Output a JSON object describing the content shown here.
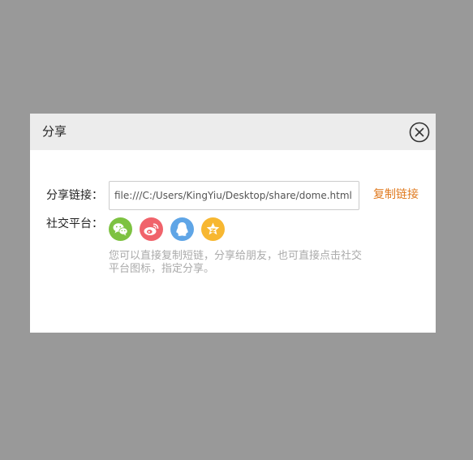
{
  "dialog": {
    "title": "分享",
    "close_icon": "close-icon"
  },
  "share": {
    "link_label": "分享链接：",
    "link_value": "file:///C:/Users/KingYiu/Desktop/share/dome.html",
    "copy_label": "复制链接",
    "social_label": "社交平台：",
    "platforms": [
      {
        "name": "wechat",
        "icon": "wechat-icon",
        "color": "#7dc241"
      },
      {
        "name": "weibo",
        "icon": "weibo-icon",
        "color": "#f0636b"
      },
      {
        "name": "qq",
        "icon": "qq-icon",
        "color": "#5fa5e6"
      },
      {
        "name": "qzone",
        "icon": "qzone-star-icon",
        "color": "#f7b731"
      }
    ],
    "hint": "您可以直接复制短链，分享给朋友，也可直接点击社交平台图标，指定分享。"
  },
  "colors": {
    "overlay": "#999999",
    "header_bg": "#ececec",
    "accent": "#e07a1f"
  }
}
